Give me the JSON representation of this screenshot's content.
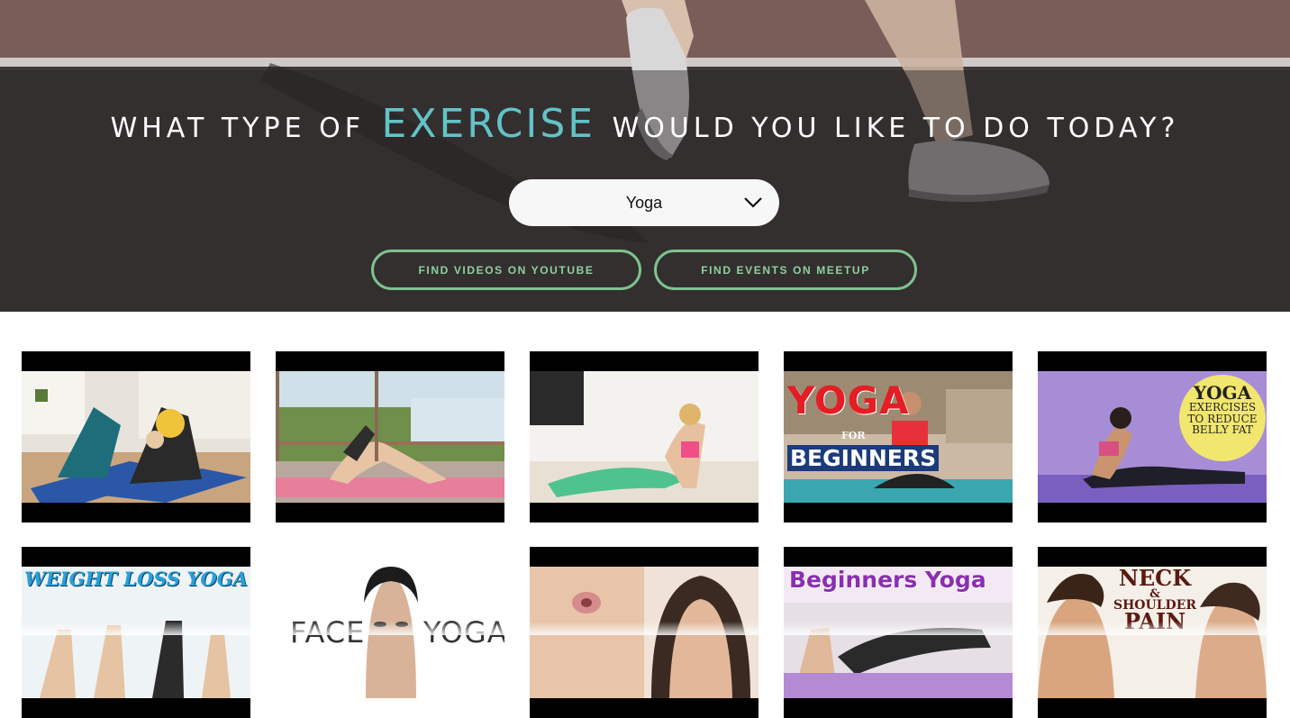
{
  "hero": {
    "question_before": "WHAT TYPE OF",
    "question_highlight": "EXERCISE",
    "question_after": "WOULD YOU LIKE TO DO TODAY?",
    "highlight_color": "#62c3c8",
    "exercise_select": {
      "selected": "Yoga",
      "icon": "chevron-down-icon"
    },
    "buttons": {
      "youtube_label": "FIND VIDEOS ON YOUTUBE",
      "meetup_label": "FIND EVENTS ON MEETUP",
      "accent_color": "#7ec28f"
    }
  },
  "videos": {
    "row1": [
      {
        "caption": ""
      },
      {
        "caption": ""
      },
      {
        "caption": ""
      },
      {
        "caption_line1": "YOGA",
        "caption_line2": "FOR",
        "caption_line3": "BEGINNERS"
      },
      {
        "caption_line1": "YOGA",
        "caption_line2": "EXERCISES",
        "caption_line3": "TO REDUCE",
        "caption_line4": "BELLY FAT"
      }
    ],
    "row2": [
      {
        "caption": "WEIGHT LOSS YOGA"
      },
      {
        "caption_left": "FACE",
        "caption_right": "YOGA"
      },
      {
        "caption": ""
      },
      {
        "caption": "Beginners Yoga"
      },
      {
        "caption_line1": "NECK",
        "caption_line2": "&",
        "caption_line3": "SHOULDER",
        "caption_line4": "PAIN"
      }
    ]
  }
}
